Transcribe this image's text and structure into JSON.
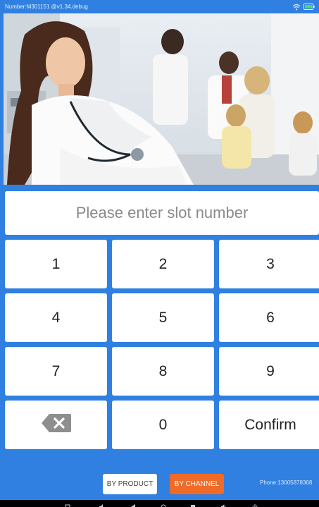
{
  "status_bar": {
    "device_info": "Number:M301151 @v1.34.debug"
  },
  "banner": {
    "image": "doctor-clinic-banner"
  },
  "slot_input": {
    "value": "",
    "placeholder": "Please enter slot number"
  },
  "keypad": {
    "k1": "1",
    "k2": "2",
    "k3": "3",
    "k4": "4",
    "k5": "5",
    "k6": "6",
    "k7": "7",
    "k8": "8",
    "k9": "9",
    "backspace_icon": "backspace-icon",
    "k0": "0",
    "confirm": "Confirm"
  },
  "modes": {
    "by_product": "BY PRODUCT",
    "by_channel": "BY CHANNEL"
  },
  "footer": {
    "phone": "Phone:13005878368"
  },
  "colors": {
    "background": "#2f80e0",
    "accent": "#f06a28",
    "key": "#ffffff"
  }
}
